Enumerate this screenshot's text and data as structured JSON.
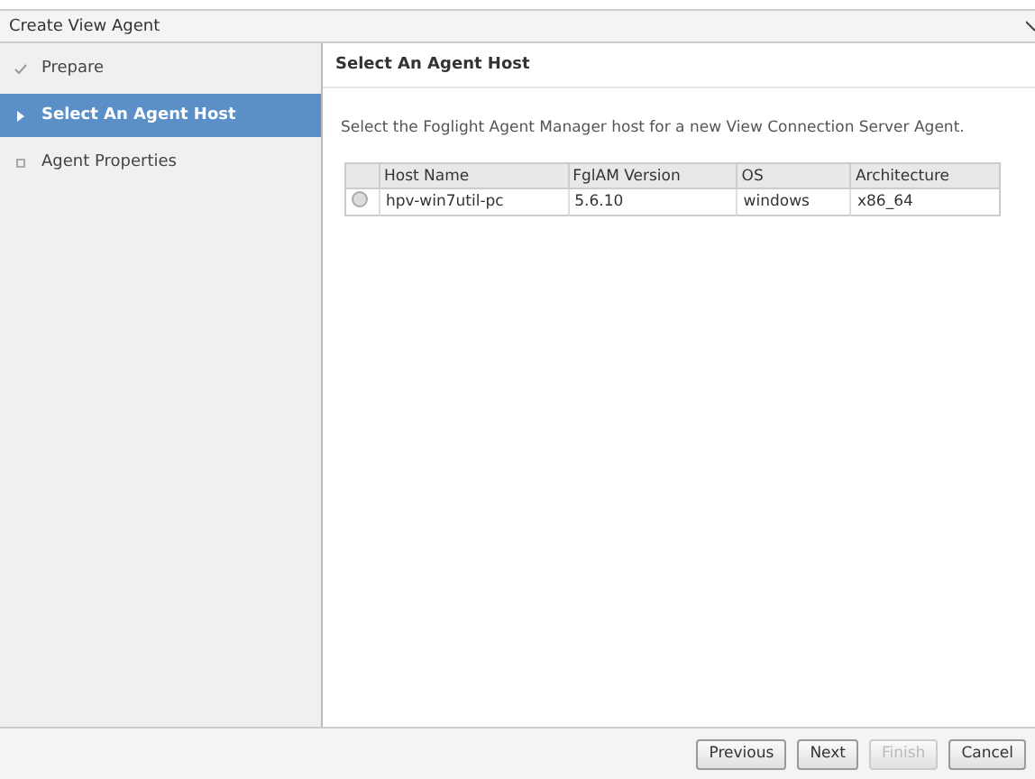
{
  "window": {
    "title": "Create View Agent"
  },
  "steps": [
    {
      "label": "Prepare",
      "kind": "done",
      "selected": false
    },
    {
      "label": "Select An Agent Host",
      "kind": "current",
      "selected": true
    },
    {
      "label": "Agent Properties",
      "kind": "pending",
      "selected": false
    }
  ],
  "panel": {
    "heading": "Select An Agent Host",
    "description": "Select the Foglight Agent Manager host for a new View Connection Server Agent."
  },
  "table": {
    "columns": [
      "Host Name",
      "FglAM Version",
      "OS",
      "Architecture"
    ],
    "rows": [
      {
        "selected": false,
        "cells": [
          "hpv-win7util-pc",
          "5.6.10",
          "windows",
          "x86_64"
        ]
      }
    ]
  },
  "buttons": [
    {
      "label": "Previous",
      "disabled": false
    },
    {
      "label": "Next",
      "disabled": false
    },
    {
      "label": "Finish",
      "disabled": true
    },
    {
      "label": "Cancel",
      "disabled": false
    }
  ]
}
